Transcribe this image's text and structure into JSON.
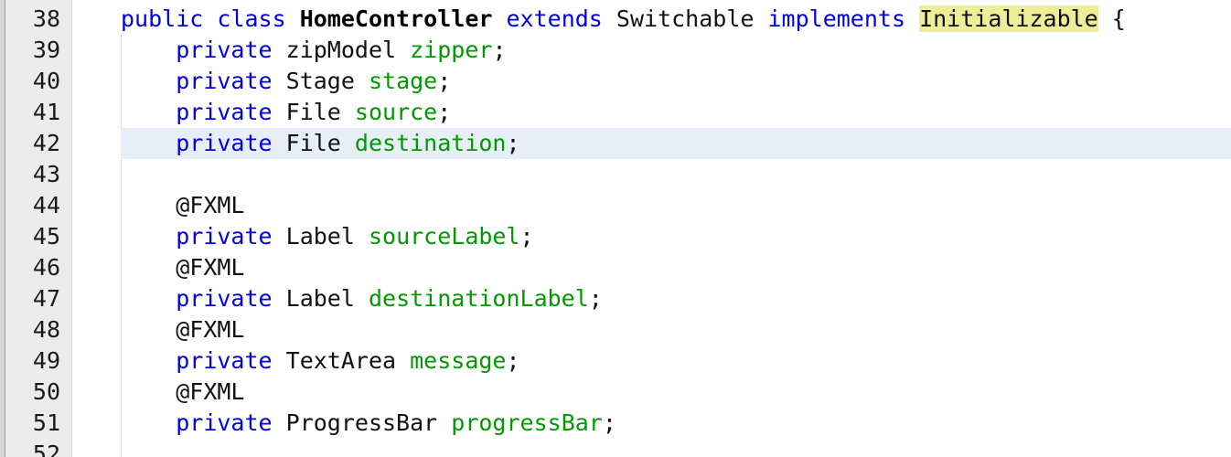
{
  "editor": {
    "lines": [
      {
        "num": "38",
        "tokens": [
          {
            "t": "public",
            "c": "kw"
          },
          {
            "t": " ",
            "c": "punc"
          },
          {
            "t": "class",
            "c": "kw"
          },
          {
            "t": " ",
            "c": "punc"
          },
          {
            "t": "HomeController",
            "c": "cls"
          },
          {
            "t": " ",
            "c": "punc"
          },
          {
            "t": "extends",
            "c": "kw"
          },
          {
            "t": " ",
            "c": "punc"
          },
          {
            "t": "Switchable",
            "c": "ty"
          },
          {
            "t": " ",
            "c": "punc"
          },
          {
            "t": "implements",
            "c": "kw"
          },
          {
            "t": " ",
            "c": "punc"
          },
          {
            "t": "Initializable",
            "c": "ty mark"
          },
          {
            "t": " {",
            "c": "punc"
          }
        ]
      },
      {
        "num": "39",
        "tokens": [
          {
            "t": "    ",
            "c": "punc"
          },
          {
            "t": "private",
            "c": "kw"
          },
          {
            "t": " ",
            "c": "punc"
          },
          {
            "t": "zipModel",
            "c": "ty"
          },
          {
            "t": " ",
            "c": "punc"
          },
          {
            "t": "zipper",
            "c": "fld"
          },
          {
            "t": ";",
            "c": "punc"
          }
        ]
      },
      {
        "num": "40",
        "tokens": [
          {
            "t": "    ",
            "c": "punc"
          },
          {
            "t": "private",
            "c": "kw"
          },
          {
            "t": " ",
            "c": "punc"
          },
          {
            "t": "Stage",
            "c": "ty"
          },
          {
            "t": " ",
            "c": "punc"
          },
          {
            "t": "stage",
            "c": "fld"
          },
          {
            "t": ";",
            "c": "punc"
          }
        ]
      },
      {
        "num": "41",
        "tokens": [
          {
            "t": "    ",
            "c": "punc"
          },
          {
            "t": "private",
            "c": "kw"
          },
          {
            "t": " ",
            "c": "punc"
          },
          {
            "t": "File",
            "c": "ty"
          },
          {
            "t": " ",
            "c": "punc"
          },
          {
            "t": "source",
            "c": "fld"
          },
          {
            "t": ";",
            "c": "punc"
          }
        ]
      },
      {
        "num": "42",
        "current": true,
        "tokens": [
          {
            "t": "    ",
            "c": "punc"
          },
          {
            "t": "private",
            "c": "kw"
          },
          {
            "t": " ",
            "c": "punc"
          },
          {
            "t": "File",
            "c": "ty"
          },
          {
            "t": " ",
            "c": "punc"
          },
          {
            "t": "destination",
            "c": "fld"
          },
          {
            "t": ";",
            "c": "punc"
          }
        ]
      },
      {
        "num": "43",
        "tokens": []
      },
      {
        "num": "44",
        "tokens": [
          {
            "t": "    ",
            "c": "punc"
          },
          {
            "t": "@FXML",
            "c": "ann"
          }
        ]
      },
      {
        "num": "45",
        "tokens": [
          {
            "t": "    ",
            "c": "punc"
          },
          {
            "t": "private",
            "c": "kw"
          },
          {
            "t": " ",
            "c": "punc"
          },
          {
            "t": "Label",
            "c": "ty"
          },
          {
            "t": " ",
            "c": "punc"
          },
          {
            "t": "sourceLabel",
            "c": "fld"
          },
          {
            "t": ";",
            "c": "punc"
          }
        ]
      },
      {
        "num": "46",
        "tokens": [
          {
            "t": "    ",
            "c": "punc"
          },
          {
            "t": "@FXML",
            "c": "ann"
          }
        ]
      },
      {
        "num": "47",
        "tokens": [
          {
            "t": "    ",
            "c": "punc"
          },
          {
            "t": "private",
            "c": "kw"
          },
          {
            "t": " ",
            "c": "punc"
          },
          {
            "t": "Label",
            "c": "ty"
          },
          {
            "t": " ",
            "c": "punc"
          },
          {
            "t": "destinationLabel",
            "c": "fld"
          },
          {
            "t": ";",
            "c": "punc"
          }
        ]
      },
      {
        "num": "48",
        "tokens": [
          {
            "t": "    ",
            "c": "punc"
          },
          {
            "t": "@FXML",
            "c": "ann"
          }
        ]
      },
      {
        "num": "49",
        "tokens": [
          {
            "t": "    ",
            "c": "punc"
          },
          {
            "t": "private",
            "c": "kw"
          },
          {
            "t": " ",
            "c": "punc"
          },
          {
            "t": "TextArea",
            "c": "ty"
          },
          {
            "t": " ",
            "c": "punc"
          },
          {
            "t": "message",
            "c": "fld"
          },
          {
            "t": ";",
            "c": "punc"
          }
        ]
      },
      {
        "num": "50",
        "tokens": [
          {
            "t": "    ",
            "c": "punc"
          },
          {
            "t": "@FXML",
            "c": "ann"
          }
        ]
      },
      {
        "num": "51",
        "tokens": [
          {
            "t": "    ",
            "c": "punc"
          },
          {
            "t": "private",
            "c": "kw"
          },
          {
            "t": " ",
            "c": "punc"
          },
          {
            "t": "ProgressBar",
            "c": "ty"
          },
          {
            "t": " ",
            "c": "punc"
          },
          {
            "t": "progressBar",
            "c": "fld"
          },
          {
            "t": ";",
            "c": "punc"
          }
        ]
      },
      {
        "num": "52",
        "tokens": []
      }
    ]
  }
}
